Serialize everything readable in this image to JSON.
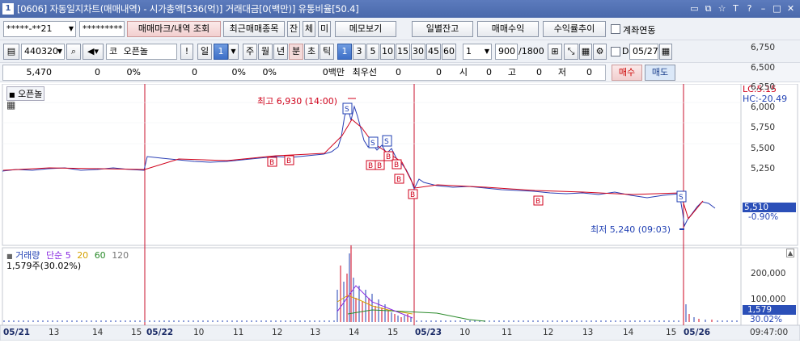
{
  "title": {
    "window_num": "1",
    "text": "[0606] 자동일지차트(매매내역) - 시가총액[536(억)] 거래대금[0(백만)] 유통비율[50.4]"
  },
  "toolbar1": {
    "account": "*****-**21",
    "password": "*********",
    "btn_trade_mark": "매매마크/내역 조회",
    "btn_recent": "최근매매종목",
    "btn_jan": "잔",
    "btn_che": "체",
    "btn_mi": "미",
    "btn_memo": "메모보기",
    "btn_daily": "일별잔고",
    "btn_profit": "매매수익",
    "btn_yield": "수익률추이",
    "link_label": "계좌연동"
  },
  "toolbar2": {
    "code": "440320",
    "market": "코",
    "name": "오픈놀",
    "excl": "!",
    "period_il": "일",
    "period_val": "1",
    "btn_ju": "주",
    "btn_wol": "월",
    "btn_nyeon": "년",
    "btn_bun": "분",
    "btn_cho": "초",
    "btn_tik": "틱",
    "intervals": [
      "1",
      "3",
      "5",
      "10",
      "15",
      "30",
      "45",
      "60"
    ],
    "interval_sel": "1",
    "count_sel": "1",
    "bars": "900",
    "bars_max": "/1800",
    "d_label": "D",
    "date": "05/27"
  },
  "infobar": {
    "price": "5,470",
    "v1": "0",
    "v2": "0%",
    "v3": "0",
    "v4": "0%",
    "v5": "0%",
    "unit": "0백만",
    "best": "최우선",
    "v6": "0",
    "v7": "0",
    "open_lbl": "시",
    "open": "0",
    "high_lbl": "고",
    "high": "0",
    "low_lbl": "저",
    "low": "0",
    "buy": "매수",
    "sell": "매도"
  },
  "chart": {
    "name": "오픈놀",
    "lc": "LC:5.15",
    "hc": "HC:-20.49",
    "high_label": "최고 6,930 (14:00)",
    "low_label": "최저 5,240 (09:03)",
    "cur_price": "5,510",
    "cur_pct": "-0.90%",
    "volume_title": "거래량",
    "ma_label": "단순",
    "ma_periods": [
      "5",
      "20",
      "60",
      "120"
    ],
    "volume_value": "1,579주(30.02%)",
    "vol_cur": "1,579",
    "vol_pct": "30.02%",
    "price_ticks": [
      "6,750",
      "6,500",
      "6,250",
      "6,000",
      "5,750",
      "5,500",
      "5,250"
    ],
    "vol_ticks": [
      "200,000",
      "100,000"
    ],
    "x_labels": [
      {
        "t": "05/21",
        "b": true
      },
      {
        "t": "13"
      },
      {
        "t": "14"
      },
      {
        "t": "15"
      },
      {
        "t": "05/22",
        "b": true
      },
      {
        "t": "10"
      },
      {
        "t": "11"
      },
      {
        "t": "12"
      },
      {
        "t": "13"
      },
      {
        "t": "14"
      },
      {
        "t": "15"
      },
      {
        "t": "05/23",
        "b": true
      },
      {
        "t": "10"
      },
      {
        "t": "11"
      },
      {
        "t": "12"
      },
      {
        "t": "13"
      },
      {
        "t": "14"
      },
      {
        "t": "15"
      },
      {
        "t": "05/26",
        "b": true
      }
    ],
    "time": "09:47:00",
    "marker_b": "B",
    "marker_s": "S"
  },
  "colors": {
    "up": "#d0021b",
    "down": "#1f3fb3",
    "accent": "#3d6fc7"
  }
}
